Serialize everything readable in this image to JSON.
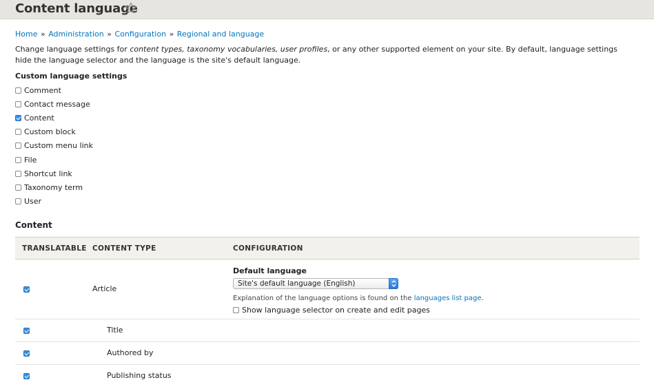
{
  "page": {
    "title": "Content language",
    "star_icon": "star-outline-icon"
  },
  "breadcrumb": [
    {
      "label": "Home"
    },
    {
      "label": "Administration"
    },
    {
      "label": "Configuration"
    },
    {
      "label": "Regional and language"
    }
  ],
  "breadcrumb_separator": "»",
  "description": {
    "part1": "Change language settings for ",
    "em1": "content types, taxonomy vocabularies, user profiles",
    "part2": ", or any other supported element on your site. By default, language settings hide the language selector and the language is the site's default language."
  },
  "custom_settings": {
    "label": "Custom language settings",
    "items": [
      {
        "label": "Comment",
        "checked": false
      },
      {
        "label": "Contact message",
        "checked": false
      },
      {
        "label": "Content",
        "checked": true
      },
      {
        "label": "Custom block",
        "checked": false
      },
      {
        "label": "Custom menu link",
        "checked": false
      },
      {
        "label": "File",
        "checked": false
      },
      {
        "label": "Shortcut link",
        "checked": false
      },
      {
        "label": "Taxonomy term",
        "checked": false
      },
      {
        "label": "User",
        "checked": false
      }
    ]
  },
  "content_section": {
    "heading": "Content",
    "columns": [
      "TRANSLATABLE",
      "CONTENT TYPE",
      "CONFIGURATION"
    ],
    "article": {
      "translatable": true,
      "type": "Article",
      "default_language_label": "Default language",
      "select_value": "Site's default language (English)",
      "help_text": "Explanation of the language options is found on the ",
      "help_link": "languages list page",
      "help_end": ".",
      "show_selector_label": "Show language selector on create and edit pages",
      "show_selector_checked": false
    },
    "fields": [
      {
        "label": "Title",
        "translatable": true
      },
      {
        "label": "Authored by",
        "translatable": true
      },
      {
        "label": "Publishing status",
        "translatable": true
      }
    ]
  },
  "colors": {
    "link": "#0074bd",
    "header_bg": "#e6e5df",
    "checkbox_on": "#3a8fe0"
  }
}
